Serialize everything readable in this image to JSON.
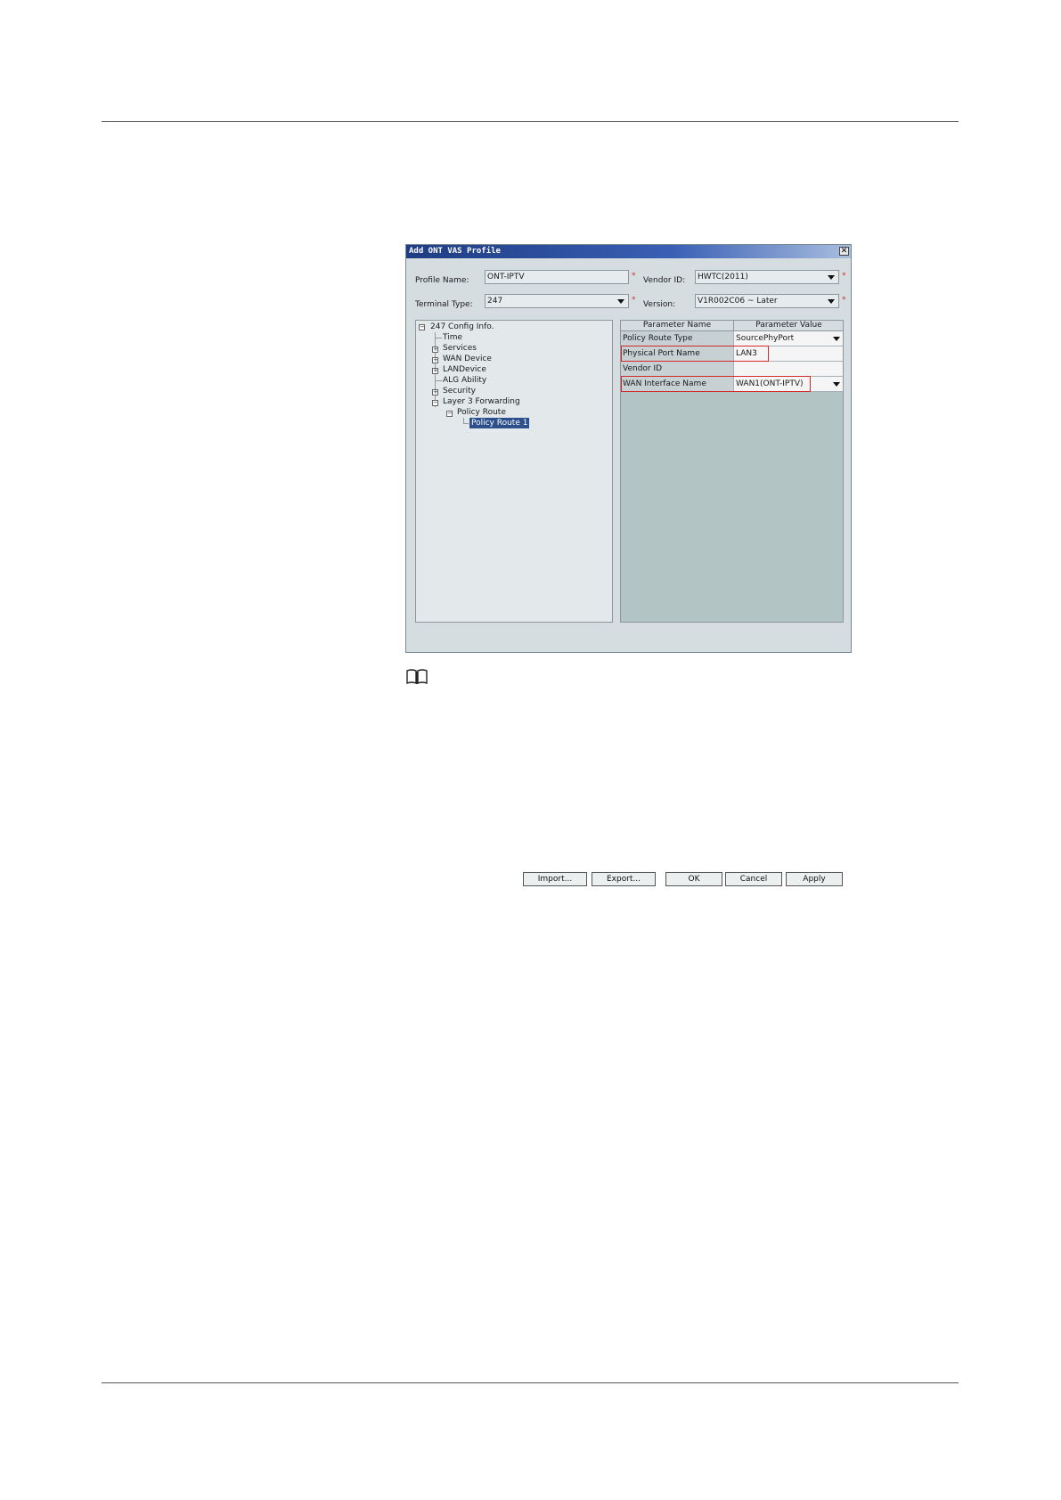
{
  "dialog": {
    "title": "Add ONT VAS Profile",
    "close": "✕",
    "profile_name_label": "Profile Name:",
    "profile_name_value": "ONT-IPTV",
    "vendor_id_label": "Vendor ID:",
    "vendor_id_value": "HWTC(2011)",
    "terminal_type_label": "Terminal Type:",
    "terminal_type_value": "247",
    "version_label": "Version:",
    "version_value": "V1R002C06 ~ Later",
    "required_mark": "*"
  },
  "tree": {
    "root": "247 Config Info.",
    "items": [
      "Time",
      "Services",
      "WAN Device",
      "LANDevice",
      "ALG Ability",
      "Security",
      "Layer 3 Forwarding"
    ],
    "policy_route": "Policy Route",
    "policy_route_1": "Policy Route 1"
  },
  "table": {
    "headers": [
      "Parameter Name",
      "Parameter Value"
    ],
    "rows": [
      {
        "name": "Policy Route Type",
        "value": "SourcePhyPort"
      },
      {
        "name": "Physical Port Name",
        "value": "LAN3"
      },
      {
        "name": "Vendor ID",
        "value": ""
      },
      {
        "name": "WAN Interface Name",
        "value": "WAN1(ONT-IPTV)"
      }
    ]
  },
  "buttons": {
    "import": "Import...",
    "export": "Export...",
    "ok": "OK",
    "cancel": "Cancel",
    "apply": "Apply"
  },
  "icons": {
    "note": "book-icon"
  }
}
